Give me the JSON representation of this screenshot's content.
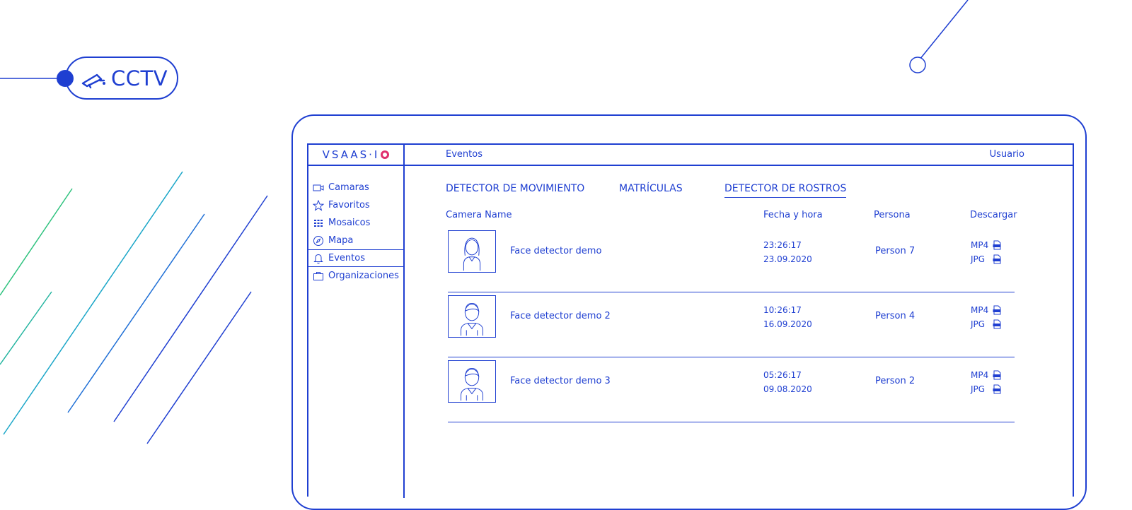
{
  "badge": {
    "label": "CCTV"
  },
  "app": {
    "logo_text": "VSAAS·I",
    "section_title": "Eventos",
    "user_label": "Usuario"
  },
  "sidebar": {
    "items": [
      {
        "label": "Camaras",
        "icon": "camera-icon",
        "active": false
      },
      {
        "label": "Favoritos",
        "icon": "star-icon",
        "active": false
      },
      {
        "label": "Mosaicos",
        "icon": "grid-icon",
        "active": false
      },
      {
        "label": "Mapa",
        "icon": "compass-icon",
        "active": false
      },
      {
        "label": "Eventos",
        "icon": "bell-icon",
        "active": true
      },
      {
        "label": "Organizaciones",
        "icon": "briefcase-icon",
        "active": false
      }
    ]
  },
  "tabs": [
    {
      "label": "DETECTOR DE MOVIMIENTO",
      "active": false
    },
    {
      "label": "MATRÍCULAS",
      "active": false
    },
    {
      "label": "DETECTOR DE ROSTROS",
      "active": true
    }
  ],
  "table": {
    "headers": {
      "camera": "Camera Name",
      "datetime": "Fecha y hora",
      "person": "Persona",
      "download": "Descargar"
    },
    "rows": [
      {
        "camera": "Face detector demo",
        "time": "23:26:17",
        "date": "23.09.2020",
        "person": "Person 7",
        "mp4": "MP4",
        "jpg": "JPG",
        "avatar": "female-avatar-icon"
      },
      {
        "camera": "Face detector demo 2",
        "time": "10:26:17",
        "date": "16.09.2020",
        "person": "Person 4",
        "mp4": "MP4",
        "jpg": "JPG",
        "avatar": "male-avatar-icon"
      },
      {
        "camera": "Face detector demo 3",
        "time": "05:26:17",
        "date": "09.08.2020",
        "person": "Person 2",
        "mp4": "MP4",
        "jpg": "JPG",
        "avatar": "male-avatar-icon"
      }
    ]
  },
  "colors": {
    "primary": "#1f3fd1",
    "accent": "#e0306e",
    "green": "#2ec27e",
    "teal": "#1aa6c8"
  }
}
